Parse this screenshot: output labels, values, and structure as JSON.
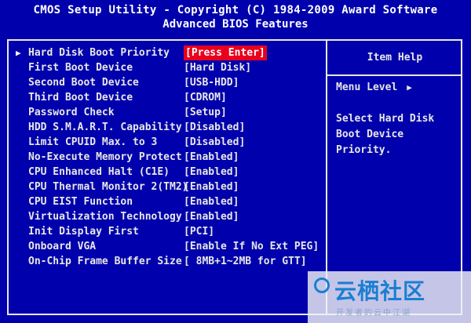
{
  "header": {
    "title_line1": "CMOS Setup Utility - Copyright (C) 1984-2009 Award Software",
    "title_line2": "Advanced BIOS Features"
  },
  "settings": [
    {
      "label": "Hard Disk Boot Priority",
      "value": "[Press Enter]",
      "selected": true
    },
    {
      "label": "First Boot Device",
      "value": "[Hard Disk]"
    },
    {
      "label": "Second Boot Device",
      "value": "[USB-HDD]"
    },
    {
      "label": "Third Boot Device",
      "value": "[CDROM]"
    },
    {
      "label": "Password Check",
      "value": "[Setup]"
    },
    {
      "label": "HDD S.M.A.R.T. Capability",
      "value": "[Disabled]"
    },
    {
      "label": "Limit CPUID Max. to 3",
      "value": "[Disabled]"
    },
    {
      "label": "No-Execute Memory Protect",
      "value": "[Enabled]"
    },
    {
      "label": "CPU Enhanced Halt (C1E)",
      "value": "[Enabled]"
    },
    {
      "label": "CPU Thermal Monitor 2(TM2)",
      "value": "[Enabled]"
    },
    {
      "label": "CPU EIST Function",
      "value": "[Enabled]"
    },
    {
      "label": "Virtualization Technology",
      "value": "[Enabled]"
    },
    {
      "label": "Init Display First",
      "value": "[PCI]"
    },
    {
      "label": "Onboard VGA",
      "value": "[Enable If No Ext PEG]"
    },
    {
      "label": "On-Chip Frame Buffer Size",
      "value": "[ 8MB+1~2MB for GTT]"
    }
  ],
  "help": {
    "title": "Item Help",
    "menu_level": "Menu Level",
    "text": "Select Hard Disk Boot Device Priority."
  },
  "watermark": {
    "big": "云栖社区",
    "small": "开发者的云中江湖"
  },
  "colors": {
    "background": "#0000ac",
    "text": "#e8e8e8",
    "highlight": "#e8001c",
    "watermark_blue": "#1a7fd1"
  }
}
